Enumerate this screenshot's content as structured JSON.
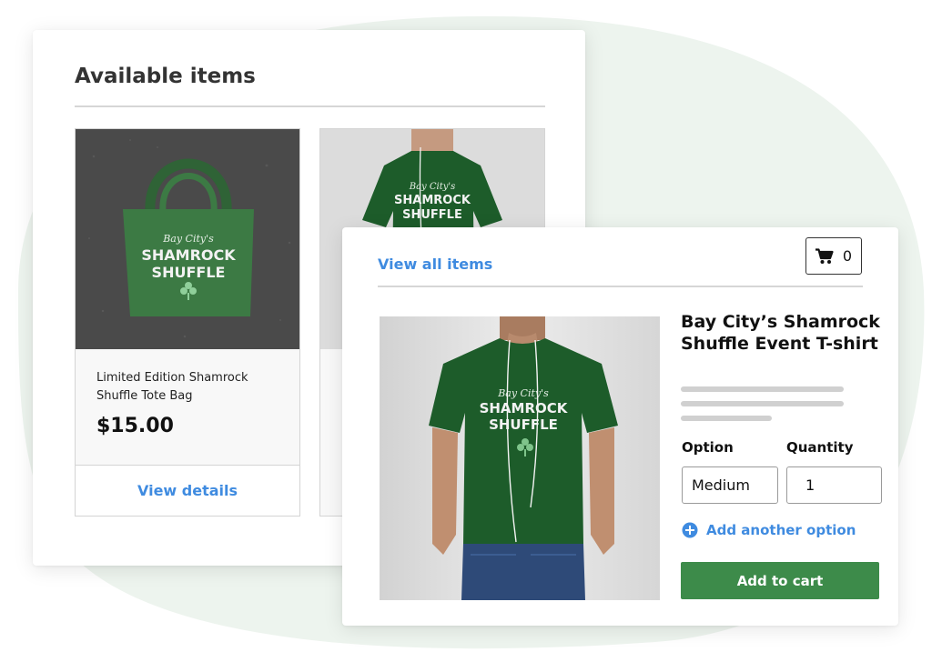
{
  "available": {
    "title": "Available items",
    "items": [
      {
        "name": "Limited Edition Shamrock Shuffle Tote Bag",
        "price": "$15.00",
        "action": "View details",
        "print_line1": "Bay City's",
        "print_line2": "SHAMROCK",
        "print_line3": "SHUFFLE"
      },
      {
        "print_line1": "Bay City's",
        "print_line2": "SHAMROCK",
        "print_line3": "SHUFFLE"
      }
    ]
  },
  "detail": {
    "view_all_label": "View all items",
    "cart_count": "0",
    "product_title": "Bay City’s Shamrock Shuffle Event T-shirt",
    "print_line1": "Bay City's",
    "print_line2": "SHAMROCK",
    "print_line3": "SHUFFLE",
    "option_label": "Option",
    "option_value": "Medium",
    "quantity_label": "Quantity",
    "quantity_value": "1",
    "add_option_label": "Add another option",
    "add_to_cart_label": "Add to cart"
  },
  "icons": {
    "cart": "cart-icon",
    "add_option": "plus-circle-icon",
    "print_motif": "shamrock-icon"
  },
  "colors": {
    "accent_blue": "#3f8be0",
    "cart_button_green": "#3d8b4a",
    "shirt_green": "#1d5c2a",
    "tote_green": "#3c7a44",
    "background_blob": "#edf4ee"
  }
}
